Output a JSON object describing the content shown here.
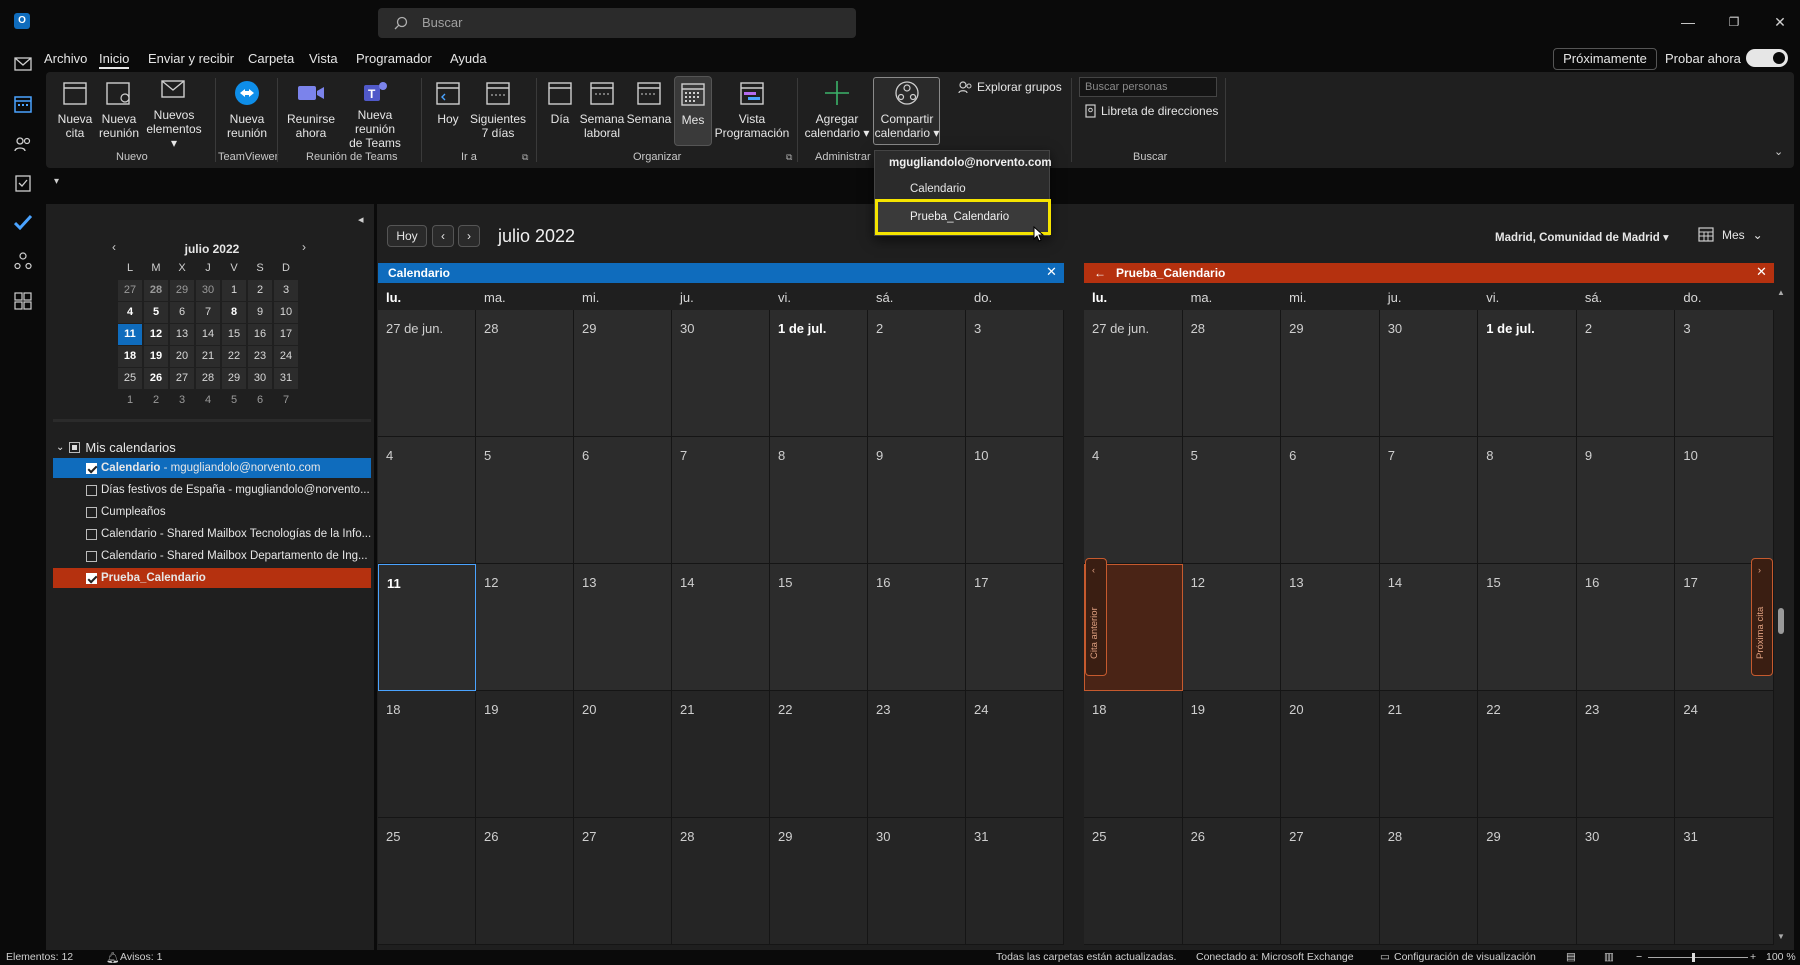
{
  "search": {
    "placeholder": "Buscar"
  },
  "menu": {
    "tabs": [
      "Archivo",
      "Inicio",
      "Enviar y recibir",
      "Carpeta",
      "Vista",
      "Programador",
      "Ayuda"
    ],
    "proximamente": "Próximamente",
    "probar_ahora": "Probar ahora"
  },
  "ribbon": {
    "nueva_cita": [
      "Nueva",
      "cita"
    ],
    "nueva_reunion": [
      "Nueva",
      "reunión"
    ],
    "nuevos_elementos": [
      "Nuevos",
      "elementos ▾"
    ],
    "tv_nueva_reunion": [
      "Nueva",
      "reunión"
    ],
    "reunirse_ahora": [
      "Reunirse",
      "ahora"
    ],
    "nueva_reunion_teams": [
      "Nueva reunión",
      "de Teams"
    ],
    "hoy": "Hoy",
    "siguientes": [
      "Siguientes",
      "7 días"
    ],
    "dia": "Día",
    "semana_laboral": [
      "Semana",
      "laboral"
    ],
    "semana": "Semana",
    "mes": "Mes",
    "vista_programacion": [
      "Vista",
      "Programación"
    ],
    "agregar_calendario": [
      "Agregar",
      "calendario ▾"
    ],
    "compartir_calendario": [
      "Compartir",
      "calendario ▾"
    ],
    "explorar_grupos": "Explorar grupos",
    "buscar_personas": "Buscar personas",
    "libreta": "Libreta de direcciones",
    "groups": {
      "nuevo": "Nuevo",
      "teamviewer": "TeamViewer",
      "reunion_teams": "Reunión de Teams",
      "ir_a": "Ir a",
      "organizar": "Organizar",
      "administrar": "Administrar",
      "buscar": "Buscar"
    }
  },
  "popup": {
    "account": "mgugliandolo@norvento.com",
    "items": [
      "Calendario",
      "Prueba_Calendario"
    ]
  },
  "minical": {
    "title": "julio 2022",
    "weekdays": [
      "L",
      "M",
      "X",
      "J",
      "V",
      "S",
      "D"
    ],
    "weeks": [
      [
        "27",
        "28",
        "29",
        "30",
        "1",
        "2",
        "3"
      ],
      [
        "4",
        "5",
        "6",
        "7",
        "8",
        "9",
        "10"
      ],
      [
        "11",
        "12",
        "13",
        "14",
        "15",
        "16",
        "17"
      ],
      [
        "18",
        "19",
        "20",
        "21",
        "22",
        "23",
        "24"
      ],
      [
        "25",
        "26",
        "27",
        "28",
        "29",
        "30",
        "31"
      ],
      [
        "1",
        "2",
        "3",
        "4",
        "5",
        "6",
        "7"
      ]
    ]
  },
  "my_calendars": {
    "title": "Mis calendarios",
    "items": [
      {
        "label": "Calendario",
        "suffix": " - mgugliandolo@norvento.com",
        "checked": true,
        "highlight": "#0f6cbd"
      },
      {
        "label": "Días festivos de España - mgugliandolo@norvento...",
        "suffix": "",
        "checked": false,
        "highlight": ""
      },
      {
        "label": "Cumpleaños",
        "suffix": "",
        "checked": false,
        "highlight": ""
      },
      {
        "label": "Calendario - Shared Mailbox Tecnologías de la Info...",
        "suffix": "",
        "checked": false,
        "highlight": ""
      },
      {
        "label": "Calendario - Shared Mailbox Departamento de Ing...",
        "suffix": "",
        "checked": false,
        "highlight": ""
      },
      {
        "label": "Prueba_Calendario",
        "suffix": "",
        "checked": true,
        "highlight": "#b5310f"
      }
    ]
  },
  "main": {
    "hoy": "Hoy",
    "month_title": "julio 2022",
    "location": "Madrid, Comunidad de Madrid",
    "view": "Mes"
  },
  "calendars": [
    {
      "name": "Calendario",
      "color": "#0f6cbd"
    },
    {
      "name": "Prueba_Calendario",
      "color": "#b5310f"
    }
  ],
  "day_headers": [
    "lu.",
    "ma.",
    "mi.",
    "ju.",
    "vi.",
    "sá.",
    "do."
  ],
  "weeks": [
    [
      "27 de jun.",
      "28",
      "29",
      "30",
      "1 de jul.",
      "2",
      "3"
    ],
    [
      "4",
      "5",
      "6",
      "7",
      "8",
      "9",
      "10"
    ],
    [
      "11",
      "12",
      "13",
      "14",
      "15",
      "16",
      "17"
    ],
    [
      "18",
      "19",
      "20",
      "21",
      "22",
      "23",
      "24"
    ],
    [
      "25",
      "26",
      "27",
      "28",
      "29",
      "30",
      "31"
    ]
  ],
  "side_tabs": {
    "prev": "Cita anterior",
    "next": "Próxima cita"
  },
  "status": {
    "elementos": "Elementos: 12",
    "avisos": "Avisos: 1",
    "carpetas": "Todas las carpetas están actualizadas.",
    "conectado": "Conectado a: Microsoft Exchange",
    "config": "Configuración de visualización",
    "zoom": "100 %"
  },
  "colors": {
    "accent": "#0f6cbd",
    "prueba": "#b5310f",
    "highlight_box": "#f5e400"
  }
}
